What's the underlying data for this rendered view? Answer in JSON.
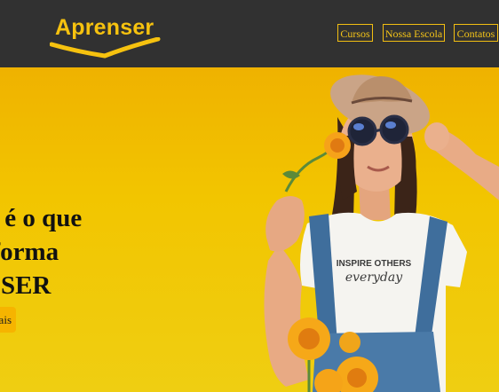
{
  "brand": {
    "name": "Aprenser"
  },
  "nav": {
    "items": [
      "Cursos",
      "Nossa Escola",
      "Contatos"
    ]
  },
  "hero": {
    "title_lines": [
      "Saber é o que",
      "transforma",
      "nosso SER"
    ],
    "cta_label": "Saiba mais",
    "shirt_text": [
      "INSPIRE OTHERS",
      "everyday"
    ]
  },
  "colors": {
    "header_bg": "#313131",
    "accent": "#f6c20f",
    "hero_bg": "#f2c400"
  }
}
